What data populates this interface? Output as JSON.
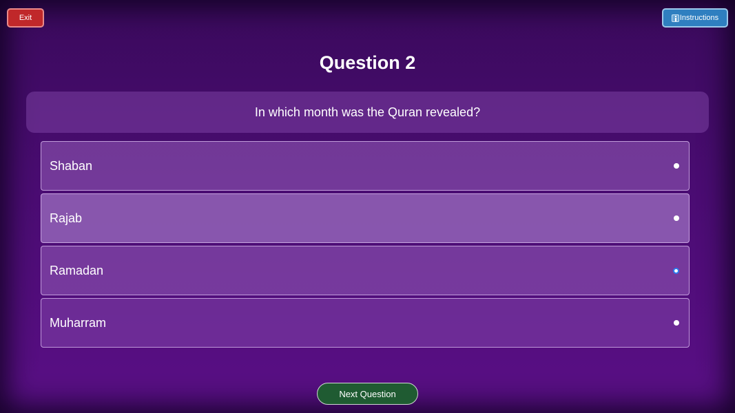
{
  "header": {
    "exit_label": "Exit",
    "instructions_label": "Instructions"
  },
  "quiz": {
    "title": "Question 2",
    "question": "In which month was the Quran revealed?",
    "options": [
      {
        "label": "Shaban"
      },
      {
        "label": "Rajab"
      },
      {
        "label": "Ramadan"
      },
      {
        "label": "Muharram"
      }
    ]
  },
  "footer": {
    "next_label": "Next Question"
  },
  "colors": {
    "background": "#4a0c72",
    "exit_button": "#c0282a",
    "instructions_button": "#2f7fc0",
    "next_button": "#1f5b32",
    "radio_focus": "#2a7cf0"
  },
  "icons": {
    "instructions": "info-icon"
  }
}
